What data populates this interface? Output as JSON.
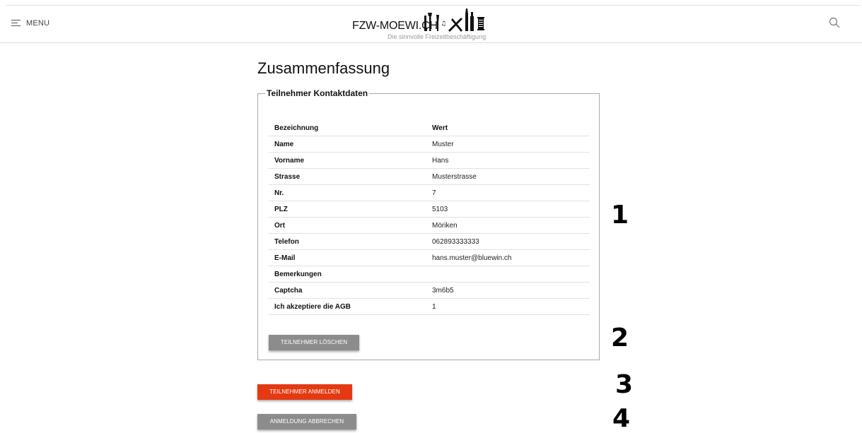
{
  "header": {
    "menu_label": "MENU",
    "logo_text": "FZW-MOEWI.CH",
    "logo_tagline": "Die sinnvolle Freizeitbeschäftigung"
  },
  "main": {
    "title": "Zusammenfassung",
    "fieldset_legend": "Teilnehmer Kontaktdaten",
    "table_headers": [
      "Bezeichnung",
      "Wert"
    ],
    "rows": [
      {
        "label": "Name",
        "value": "Muster"
      },
      {
        "label": "Vorname",
        "value": "Hans"
      },
      {
        "label": "Strasse",
        "value": "Musterstrasse"
      },
      {
        "label": "Nr.",
        "value": "7"
      },
      {
        "label": "PLZ",
        "value": "5103"
      },
      {
        "label": "Ort",
        "value": "Möriken"
      },
      {
        "label": "Telefon",
        "value": "062893333333"
      },
      {
        "label": "E-Mail",
        "value": "hans.muster@bluewin.ch"
      },
      {
        "label": "Bemerkungen",
        "value": ""
      },
      {
        "label": "Captcha",
        "value": "3m6b5"
      },
      {
        "label": "Ich akzeptiere die AGB",
        "value": "1"
      }
    ],
    "delete_button": "TEILNEHMER LÖSCHEN",
    "register_button": "TEILNEHMER ANMELDEN",
    "cancel_button": "ANMELDUNG ABBRECHEN"
  },
  "annotations": [
    "1",
    "2",
    "3",
    "4"
  ],
  "colors": {
    "primary_button": "#e43a12",
    "secondary_button": "#8c8c8c",
    "divider": "#e2e2e2"
  },
  "icons": [
    "hamburger-icon",
    "search-icon",
    "logo-tools-illustration"
  ]
}
